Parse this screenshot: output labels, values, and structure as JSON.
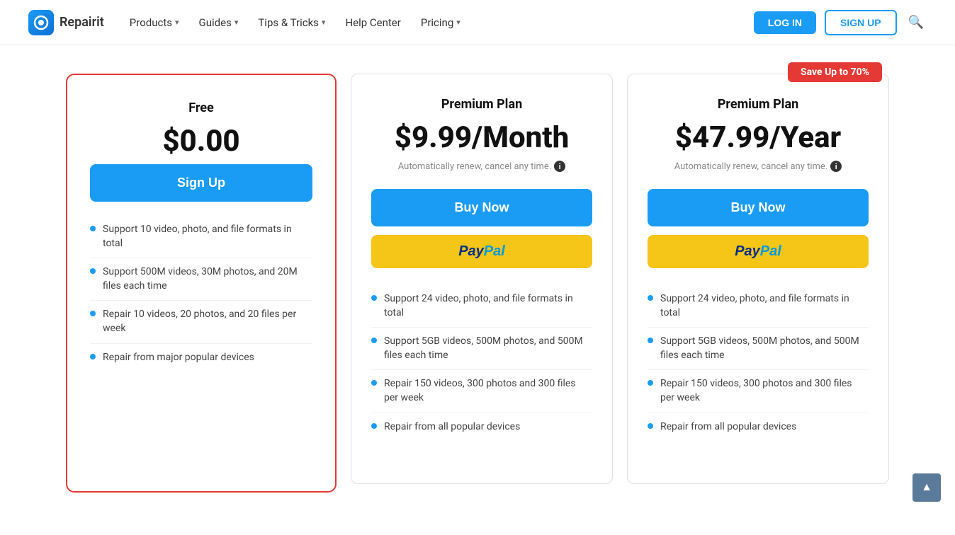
{
  "header": {
    "logo_text": "Repairit",
    "nav": [
      {
        "label": "Products",
        "has_dropdown": true
      },
      {
        "label": "Guides",
        "has_dropdown": true
      },
      {
        "label": "Tips & Tricks",
        "has_dropdown": true
      },
      {
        "label": "Help Center",
        "has_dropdown": false
      },
      {
        "label": "Pricing",
        "has_dropdown": true
      }
    ],
    "login_label": "LOG IN",
    "signup_label": "SIGN UP"
  },
  "pricing": {
    "cards": [
      {
        "id": "free",
        "highlighted": true,
        "plan_name": "Free",
        "price": "$0.00",
        "price_note": null,
        "cta_label": "Sign Up",
        "cta_type": "signup",
        "has_paypal": false,
        "save_badge": null,
        "features": [
          "Support 10 video, photo, and file formats in total",
          "Support 500M videos, 30M photos, and 20M files each time",
          "Repair 10 videos, 20 photos, and 20 files per week",
          "Repair from major popular devices"
        ]
      },
      {
        "id": "premium-monthly",
        "highlighted": false,
        "plan_name": "Premium Plan",
        "price": "$9.99/Month",
        "price_note": "Automatically renew, cancel any time.",
        "cta_label": "Buy Now",
        "cta_type": "buy",
        "has_paypal": true,
        "save_badge": null,
        "features": [
          "Support 24 video, photo, and file formats in total",
          "Support 5GB videos, 500M photos, and 500M files each time",
          "Repair 150 videos, 300 photos and 300 files per week",
          "Repair from all popular devices"
        ]
      },
      {
        "id": "premium-yearly",
        "highlighted": false,
        "plan_name": "Premium Plan",
        "price": "$47.99/Year",
        "price_note": "Automatically renew, cancel any time.",
        "cta_label": "Buy Now",
        "cta_type": "buy",
        "has_paypal": true,
        "save_badge": "Save Up to 70%",
        "features": [
          "Support 24 video, photo, and file formats in total",
          "Support 5GB videos, 500M photos, and 500M files each time",
          "Repair 150 videos, 300 photos and 300 files per week",
          "Repair from all popular devices"
        ]
      }
    ]
  }
}
